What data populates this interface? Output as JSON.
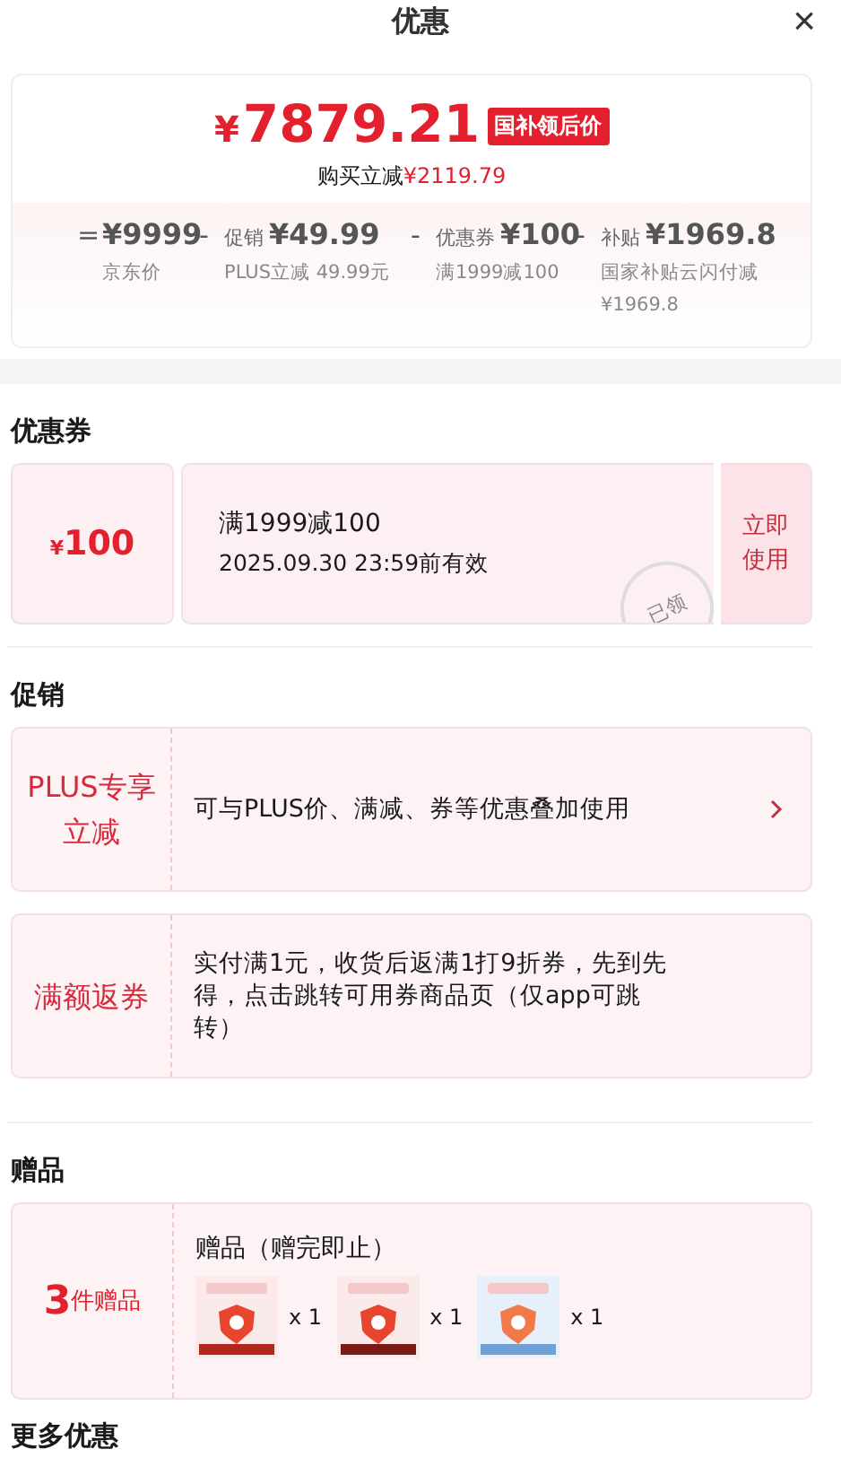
{
  "header": {
    "title": "优惠",
    "close": "×"
  },
  "summary": {
    "price_symbol": "¥",
    "price": "7879.21",
    "price_tag": "国补领后价",
    "saving_label": "购买立减",
    "saving": "¥2119.79",
    "breakdown": [
      {
        "op": "=",
        "amount": "¥9999",
        "note": "京东价"
      },
      {
        "op": "-",
        "label": "促销",
        "amount": "¥49.99",
        "note": "PLUS立减 49.99元"
      },
      {
        "op": "-",
        "label": "优惠券",
        "amount": "¥100",
        "note": "满1999减100"
      },
      {
        "op": "-",
        "label": "补贴",
        "amount": "¥1969.8",
        "note": "国家补贴云闪付减¥1969.8"
      }
    ]
  },
  "coupons": {
    "heading": "优惠券",
    "items": [
      {
        "symbol": "¥",
        "value": "100",
        "title": "满1999减100",
        "expiry": "2025.09.30 23:59前有效",
        "stamp": "已领",
        "action": "立即使用"
      }
    ]
  },
  "promotions": {
    "heading": "促销",
    "items": [
      {
        "tag": "PLUS专享立减",
        "text": "可与PLUS价、满减、券等优惠叠加使用",
        "chevron": true
      },
      {
        "tag": "满额返券",
        "text": "实付满1元，收货后返满1打9折券，先到先得，点击跳转可用券商品页（仅app可跳转）",
        "chevron": false
      }
    ]
  },
  "gifts": {
    "heading": "赠品",
    "count": "3",
    "count_unit": "件赠品",
    "title": "赠品（赠完即止）",
    "items": [
      {
        "kind": "picture",
        "qty": "x 1"
      },
      {
        "kind": "picture",
        "qty": "x 1"
      },
      {
        "kind": "picture",
        "qty": "x 1"
      }
    ]
  },
  "more": {
    "heading": "更多优惠"
  }
}
